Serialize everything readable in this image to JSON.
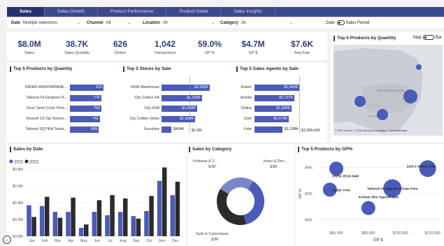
{
  "tabs": [
    {
      "label": "Sales",
      "active": true
    },
    {
      "label": "Sales Growth",
      "active": false
    },
    {
      "label": "Product Performance",
      "active": false
    },
    {
      "label": "Product Detail",
      "active": false
    },
    {
      "label": "Sales Insights",
      "active": false
    }
  ],
  "filters": {
    "date_label": "Date",
    "date_value": "Multiple selections",
    "channel_label": "Channel",
    "channel_value": "All",
    "location_label": "Location",
    "location_value": "All",
    "category_label": "Category",
    "category_value": "All",
    "date_toggle_label": "Date",
    "sales_period_label": "Sales Period"
  },
  "kpis": [
    {
      "value": "$8.0M",
      "label": "Sales"
    },
    {
      "value": "38.7K",
      "label": "Sales Quantity"
    },
    {
      "value": "626",
      "label": "Orders"
    },
    {
      "value": "1,042",
      "label": "Transactions"
    },
    {
      "value": "59.0%",
      "label": "GP %"
    },
    {
      "value": "$4.7M",
      "label": "GP $"
    },
    {
      "value": "$7.6K",
      "label": "Avg Sale"
    }
  ],
  "map": {
    "title": "Top 5 Products by Quantity",
    "toggle_left": "Map",
    "toggle_right": "Bar",
    "attribution": "© 2025 TomTom, © 2025 Microsoft Corporation, © OpenStreetMap",
    "label_new_south_wales": "NEW SOUTH WALES",
    "label_victoria": "VICTORIA"
  },
  "products_by_qty": {
    "title": "Top 5 Products by Quantity",
    "items": [
      {
        "label": "DENIM WINDOWPANE...",
        "value": 819,
        "text": "819"
      },
      {
        "label": "Tailored Fit Gingham R...",
        "value": 770,
        "text": "770"
      },
      {
        "label": "'Zeus' Semi Circle Print...",
        "value": 763,
        "text": "763"
      },
      {
        "label": "Russell 1/2 Zip Texture...",
        "value": 741,
        "text": "741"
      },
      {
        "label": "Tailored SQT404 Textur...",
        "value": 699,
        "text": "699"
      }
    ]
  },
  "stores_by_sale": {
    "title": "Top 5 Stores by Sale",
    "items": [
      {
        "label": "NSW Warehouse",
        "value": 2.283,
        "text": "$2,283K"
      },
      {
        "label": "City Cellars SA",
        "value": 1.916,
        "text": "$1,916K"
      },
      {
        "label": "City HUB",
        "value": 1.688,
        "text": "$1,688K"
      },
      {
        "label": "City Cellars Glebe",
        "value": 1.598,
        "text": "$1,598K"
      },
      {
        "label": "Sunshine",
        "value": 0.464,
        "text": "$464K"
      }
    ],
    "total_text": "$1.6M"
  },
  "agents_by_sale": {
    "title": "Top 5 Sales Agents by Sale",
    "items": [
      {
        "label": "Ruben",
        "value": 1.94,
        "text": "$1,940K"
      },
      {
        "label": "Amelia",
        "value": 1.727,
        "text": "$1,727K"
      },
      {
        "label": "Online",
        "value": 1.594,
        "text": "$1,594K"
      },
      {
        "label": "Josh",
        "value": 1.479,
        "text": "$1,479K"
      },
      {
        "label": "Kate",
        "value": 1.198,
        "text": "$1,198K"
      }
    ],
    "total_text": "$1,589,449"
  },
  "colors": {
    "primary": "#4b5bb7",
    "dark": "#2b2b2b",
    "navy": "#2e3a7c",
    "tabbar": "#3b4a8c"
  },
  "chart_data": [
    {
      "id": "sales_by_date",
      "type": "bar",
      "title": "Sales by Date",
      "categories": [
        "Jan",
        "Feb",
        "Mar",
        "Apr",
        "May",
        "Jun",
        "Jul",
        "Aug",
        "Sep",
        "Oct",
        "Nov",
        "Dec"
      ],
      "series": [
        {
          "name": "2021",
          "values": [
            0.37,
            0.36,
            0.29,
            0.29,
            0.1,
            0.29,
            0.25,
            0.29,
            0.24,
            0.3,
            0.66,
            0.49
          ]
        },
        {
          "name": "2022",
          "values": [
            0.23,
            0.47,
            0.22,
            0.46,
            0.14,
            0.43,
            0.49,
            0.45,
            0.21,
            0.48,
            0.82,
            0.65
          ]
        }
      ],
      "yticks": [
        "$0.8M",
        "$0.6M",
        "$0.4M",
        "$0.2M",
        "$0.0M"
      ],
      "ylim": [
        0,
        0.8
      ],
      "legend": "top-left"
    },
    {
      "id": "sales_by_category",
      "type": "pie",
      "title": "Sales by Category",
      "slices": [
        {
          "name": "Jeans & Den...",
          "value": 3,
          "text": "$3M",
          "color": "#4b5bb7"
        },
        {
          "name": "Suits & Cameowear",
          "value": 3,
          "text": "$3M",
          "color": "#2b2b2b"
        },
        {
          "name": "Knitwear & S...",
          "value": 2,
          "text": "$2M",
          "color": "#7b87c9"
        }
      ],
      "labels": {
        "knit": "Knitwear & S...",
        "knit_val": "$2M",
        "jeans": "Jeans & Den...",
        "jeans_val": "$3M",
        "suits": "Suits & Cameowear",
        "suits_val": "$3M"
      }
    },
    {
      "id": "products_by_gp",
      "type": "scatter",
      "title": "Top 5 Products by GP%",
      "xlabel": "GP $",
      "ylabel": "GP %",
      "xticks": [
        "$60,000",
        "$80,000",
        "$100,000",
        "$120,000"
      ],
      "yticks": [
        "84%",
        "82%",
        "80%"
      ],
      "xlim": [
        50000,
        125000
      ],
      "ylim": [
        79.5,
        84.5
      ],
      "points": [
        {
          "label": "CREW JEAN 3445",
          "x": 60000,
          "y": 83.9,
          "size": 10
        },
        {
          "label": "Zack 2 Skinny Jean",
          "x": 117000,
          "y": 83.9,
          "size": 12
        },
        {
          "label": "Script Crew",
          "x": 56000,
          "y": 82.3,
          "size": 10
        },
        {
          "label": "Tailored Fit Light Blue Chain Print",
          "x": 95000,
          "y": 82.4,
          "size": 13
        },
        {
          "label": "Kristian Slim Tapered Jean",
          "x": 80000,
          "y": 80.9,
          "size": 10
        }
      ]
    }
  ]
}
